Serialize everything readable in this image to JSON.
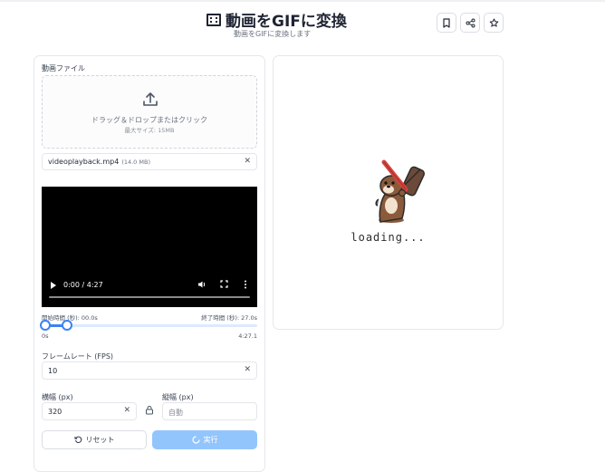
{
  "header": {
    "title": "動画をGIFに変換",
    "subtitle": "動画をGIFに変換します",
    "icons": [
      "film-icon",
      "bookmark-icon",
      "share-icon",
      "star-icon"
    ]
  },
  "form": {
    "video_file_label": "動画ファイル",
    "dropzone_text": "ドラッグ＆ドロップまたはクリック",
    "dropzone_subtext": "最大サイズ: 15MB",
    "file_name": "videoplayback.mp4",
    "file_size": "(14.0 MB)",
    "video_time": "0:00 / 4:27",
    "start_label": "開始時間 (秒): 00.0s",
    "end_label": "終了時間 (秒): 27.0s",
    "range_min": "0s",
    "range_max": "4:27.1",
    "range_start_fraction": 0.0,
    "range_end_fraction": 0.101,
    "fps_label": "フレームレート (FPS)",
    "fps_value": "10",
    "width_label": "横幅 (px)",
    "width_value": "320",
    "height_label": "縦幅 (px)",
    "height_placeholder": "自動",
    "reset_label": "リセット",
    "run_label": "実行"
  },
  "preview": {
    "loading_text": "loading..."
  },
  "colors": {
    "accent": "#3b82f6",
    "run_button_disabled": "#93c5fd",
    "border": "#e5e7eb"
  }
}
